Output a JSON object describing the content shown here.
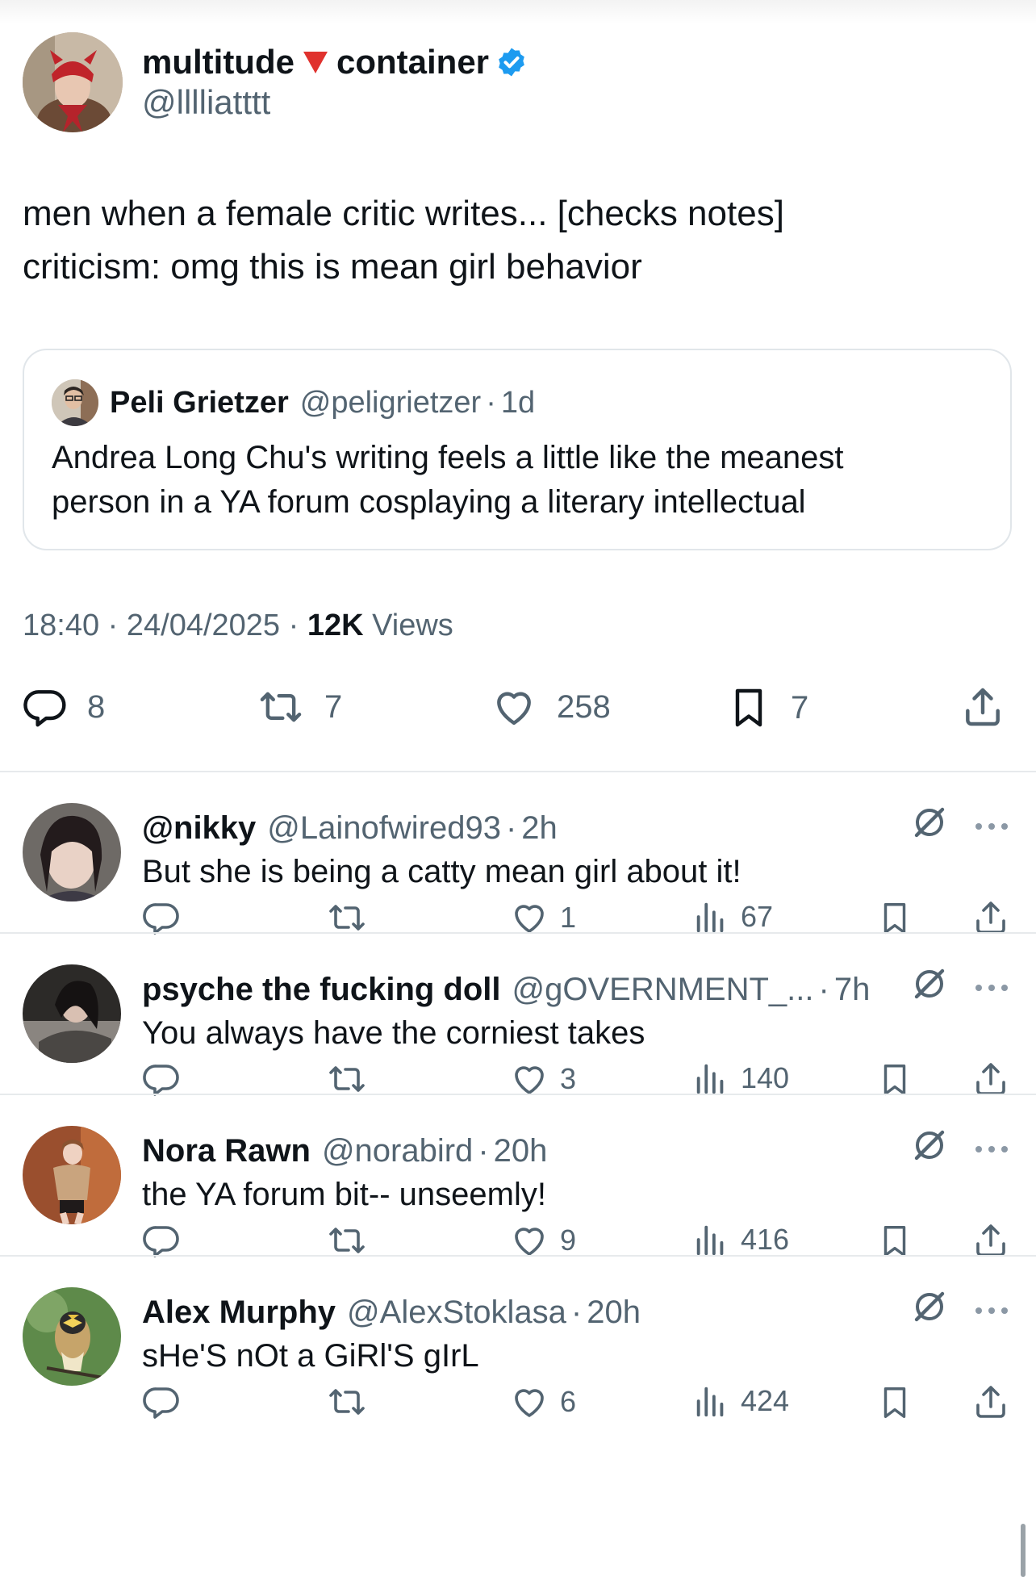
{
  "main_tweet": {
    "display_name_first": "multitude",
    "display_name_second": "container",
    "handle": "@lllliatttt",
    "text_line1": "men when a female critic writes... [checks notes]",
    "text_line2": "criticism: omg this is mean girl behavior",
    "time": "18:40",
    "date": "24/04/2025",
    "views_count": "12K",
    "views_label": "Views",
    "replies": "8",
    "reposts": "7",
    "likes": "258",
    "bookmarks": "7"
  },
  "quoted_tweet": {
    "display_name": "Peli Grietzer",
    "handle": "@peligrietzer",
    "time": "1d",
    "text_line1": "Andrea Long Chu's writing feels a little like the meanest",
    "text_line2": "person in a YA forum cosplaying a literary intellectual"
  },
  "separator": "·",
  "replies": [
    {
      "name": "@nikky",
      "handle": "@Lainofwired93",
      "time": "2h",
      "text": "But she is being a catty mean girl about it!",
      "likes": "1",
      "views": "67"
    },
    {
      "name": "psyche the fucking doll",
      "handle": "@gOVERNMENT_...",
      "time": "7h",
      "text": "You always have the corniest takes",
      "likes": "3",
      "views": "140"
    },
    {
      "name": "Nora Rawn",
      "handle": "@norabird",
      "time": "20h",
      "text": "the YA forum bit-- unseemly!",
      "likes": "9",
      "views": "416"
    },
    {
      "name": "Alex Murphy",
      "handle": "@AlexStoklasa",
      "time": "20h",
      "text": "sHe'S nOt a GiRl'S gIrL",
      "likes": "6",
      "views": "424"
    }
  ],
  "icons": {
    "verified": "verified-badge-icon",
    "triangle": "red-triangle-emoji",
    "reply": "reply-icon",
    "repost": "repost-icon",
    "like": "heart-icon",
    "bookmark": "bookmark-icon",
    "share": "share-icon",
    "views": "views-icon",
    "grok": "grok-icon",
    "more": "more-icon"
  },
  "colors": {
    "text": "#0f1419",
    "muted": "#536471",
    "verified": "#1d9bf0",
    "triangle": "#e0322e",
    "border": "#e1e6ea"
  }
}
